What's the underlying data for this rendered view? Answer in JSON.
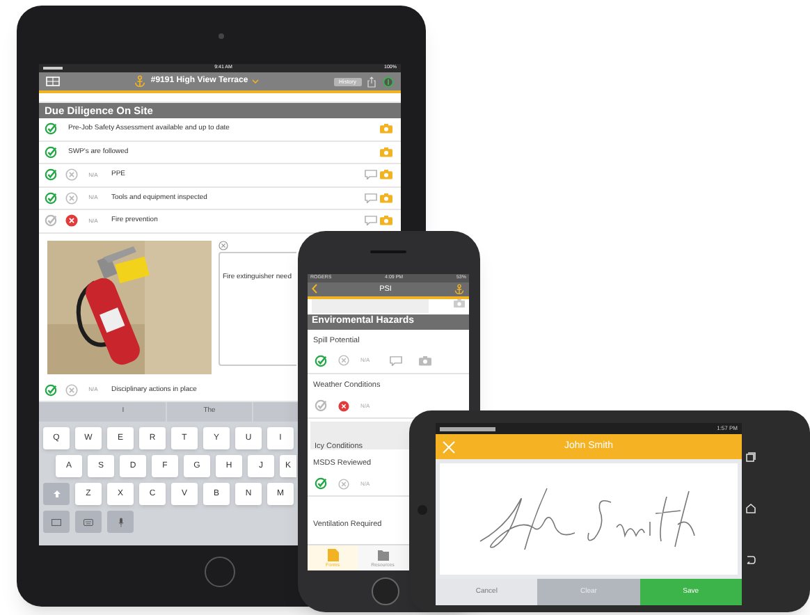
{
  "tablet": {
    "status_bar": {
      "time": "9:41 AM",
      "battery": "100%"
    },
    "nav": {
      "title": "#9191 High View Terrace",
      "history_button": "History"
    },
    "section_title": "Due Diligence On Site",
    "rows": [
      {
        "kind": "simple",
        "label": "Pre-Job Safety Assessment available and up to date",
        "checked": true
      },
      {
        "kind": "simple",
        "label": "SWP's are followed",
        "checked": true
      },
      {
        "kind": "triple",
        "label": "PPE",
        "checked": true,
        "crossed": false,
        "na": "N/A"
      },
      {
        "kind": "triple",
        "label": "Tools and equipment inspected",
        "checked": true,
        "crossed": false,
        "na": "N/A"
      },
      {
        "kind": "triple",
        "label": "Fire prevention",
        "checked": false,
        "crossed": true,
        "na": "N/A"
      }
    ],
    "photo_note": {
      "kind": "picture",
      "comment": "Fire extinguisher need"
    },
    "last_row": {
      "kind": "triple",
      "label": "Disciplinary actions in place",
      "checked": true,
      "crossed": false,
      "na": "N/A"
    },
    "keyboard": {
      "suggestions": [
        "I",
        "The"
      ],
      "rows": [
        [
          "Q",
          "W",
          "E",
          "R",
          "T",
          "Y",
          "U",
          "I"
        ],
        [
          "A",
          "S",
          "D",
          "F",
          "G",
          "H",
          "J",
          "K"
        ],
        [
          "Z",
          "X",
          "C",
          "V",
          "B",
          "N",
          "M"
        ]
      ]
    }
  },
  "phone": {
    "status_bar": {
      "carrier": "ROGERS",
      "time": "4:09 PM",
      "battery": "53%"
    },
    "nav": {
      "title": "PSI"
    },
    "section_title": "Enviromental Hazards",
    "items": [
      {
        "kind": "question",
        "label": "Spill Potential",
        "checked": true,
        "crossed": false,
        "na": "N/A",
        "attachments": true
      },
      {
        "kind": "question",
        "label": "Weather Conditions",
        "checked": false,
        "crossed": true,
        "na": "N/A"
      },
      {
        "kind": "note",
        "label": "Icy Conditions"
      },
      {
        "kind": "question",
        "label": "MSDS Reviewed",
        "checked": true,
        "crossed": false,
        "na": "N/A"
      },
      {
        "kind": "title",
        "label": "Ventilation Required"
      }
    ],
    "tabs": [
      {
        "label": "Forms",
        "selected": true
      },
      {
        "label": "Resources",
        "selected": false
      }
    ]
  },
  "android": {
    "status_bar": {
      "time": "1:57 PM"
    },
    "title": "John Smith",
    "buttons": [
      {
        "kind": "cancel",
        "label": "Cancel"
      },
      {
        "kind": "clear",
        "label": "Clear"
      },
      {
        "kind": "save",
        "label": "Save"
      }
    ]
  }
}
